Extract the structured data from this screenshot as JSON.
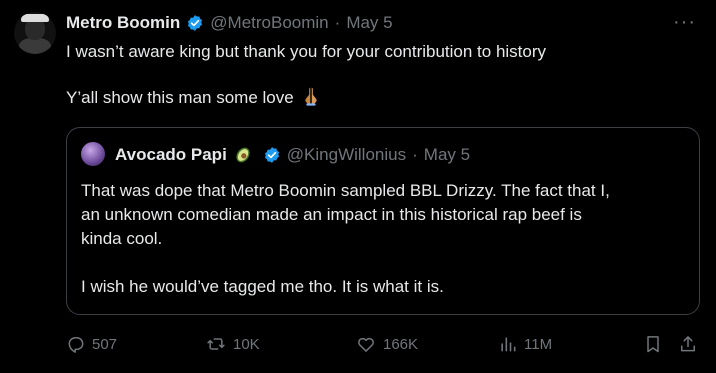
{
  "tweet": {
    "author_name": "Metro Boomin",
    "handle": "@MetroBoomin",
    "separator": "·",
    "date": "May 5",
    "line1": "I wasn’t aware king but thank you for your contribution to history",
    "line2": "Y’all show this man some love",
    "emoji": "folded-hands"
  },
  "quote": {
    "author_name": "Avocado Papi",
    "handle": "@KingWillonius",
    "separator": "·",
    "date": "May 5",
    "paragraph1_line1": "That was dope that Metro Boomin sampled BBL Drizzy. The fact that I,",
    "paragraph1_line2": "an unknown comedian made an impact in this historical rap beef is",
    "paragraph1_line3": "kinda cool.",
    "paragraph2": "I wish he would’ve tagged me tho. It is what it is."
  },
  "actions": {
    "replies": "507",
    "reposts": "10K",
    "likes": "166K",
    "views": "11M"
  },
  "colors": {
    "background": "#000000",
    "text": "#e7e9ea",
    "muted": "#71767b",
    "verified": "#1d9bf0",
    "border": "#3a3f44"
  },
  "icons": [
    "more-icon",
    "verified-icon",
    "avocado-icon",
    "reply-icon",
    "repost-icon",
    "like-icon",
    "views-icon",
    "bookmark-icon",
    "share-icon"
  ]
}
